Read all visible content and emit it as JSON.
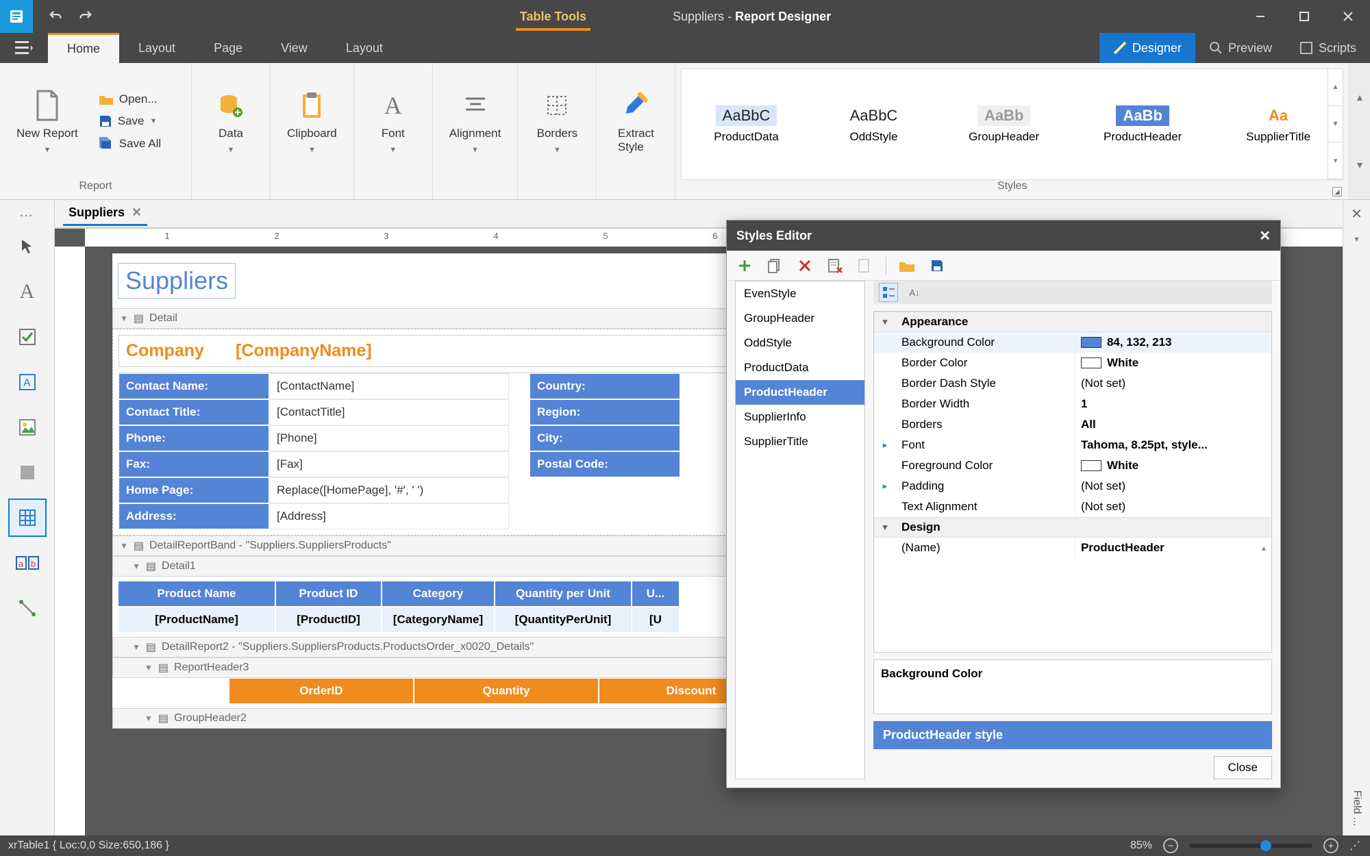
{
  "app": {
    "context_tab": "Table Tools",
    "doc_name": "Suppliers",
    "title_suffix": "Report Designer"
  },
  "ribbon_tabs": [
    "Home",
    "Layout",
    "Page",
    "View",
    "Layout"
  ],
  "modes": {
    "designer": "Designer",
    "preview": "Preview",
    "scripts": "Scripts"
  },
  "ribbon": {
    "report_group": "Report",
    "new_report": "New Report",
    "open": "Open...",
    "save": "Save",
    "save_all": "Save All",
    "data": "Data",
    "clipboard": "Clipboard",
    "font": "Font",
    "alignment": "Alignment",
    "borders": "Borders",
    "extract_style": "Extract\nStyle",
    "styles_group": "Styles"
  },
  "style_items": [
    {
      "name": "ProductData",
      "sample": "AaBbC",
      "bg": "#d6e6fb",
      "fg": "#222",
      "bold": false
    },
    {
      "name": "OddStyle",
      "sample": "AaBbC",
      "bg": "#ffffff",
      "fg": "#222",
      "bold": false
    },
    {
      "name": "GroupHeader",
      "sample": "AaBb",
      "bg": "#efefef",
      "fg": "#9a9a9a",
      "bold": true
    },
    {
      "name": "ProductHeader",
      "sample": "AaBb",
      "bg": "#5484d5",
      "fg": "#ffffff",
      "bold": true
    },
    {
      "name": "SupplierTitle",
      "sample": "Aa",
      "bg": "#ffffff",
      "fg": "#f08b1d",
      "bold": true
    }
  ],
  "doc_tab": "Suppliers",
  "ruler_ticks": [
    "1",
    "2",
    "3",
    "4",
    "5",
    "6"
  ],
  "report": {
    "title": "Suppliers",
    "band_detail": "Detail",
    "company_label": "Company",
    "company_value": "[CompanyName]",
    "rows": [
      {
        "l": "Contact Name:",
        "v": "[ContactName]",
        "r": "Country:"
      },
      {
        "l": "Contact Title:",
        "v": "[ContactTitle]",
        "r": "Region:"
      },
      {
        "l": "Phone:",
        "v": "[Phone]",
        "r": "City:"
      },
      {
        "l": "Fax:",
        "v": "[Fax]",
        "r": "Postal Code:"
      },
      {
        "l": "Home Page:",
        "v": "Replace([HomePage], '#', ' ')",
        "r": ""
      },
      {
        "l": "Address:",
        "v": "[Address]",
        "r": ""
      }
    ],
    "band_detailreport": "DetailReportBand - \"Suppliers.SuppliersProducts\"",
    "band_detail1": "Detail1",
    "products_header": [
      "Product Name",
      "Product ID",
      "Category",
      "Quantity per Unit",
      "U..."
    ],
    "products_row": [
      "[ProductName]",
      "[ProductID]",
      "[CategoryName]",
      "[QuantityPerUnit]",
      "[U"
    ],
    "band_detailreport2": "DetailReport2 - \"Suppliers.SuppliersProducts.ProductsOrder_x0020_Details\"",
    "band_reportheader3": "ReportHeader3",
    "orders_header": [
      "OrderID",
      "Quantity",
      "Discount"
    ],
    "band_groupheader2": "GroupHeader2"
  },
  "right_dock": {
    "field": "Field ..."
  },
  "styles_editor": {
    "title": "Styles Editor",
    "list": [
      "EvenStyle",
      "GroupHeader",
      "OddStyle",
      "ProductData",
      "ProductHeader",
      "SupplierInfo",
      "SupplierTitle"
    ],
    "selected": "ProductHeader",
    "categories": {
      "appearance": "Appearance",
      "design": "Design"
    },
    "props": {
      "bgcolor_k": "Background Color",
      "bgcolor_v": "84, 132, 213",
      "bgcolor_hex": "#5484d5",
      "bordercolor_k": "Border Color",
      "bordercolor_v": "White",
      "bordercolor_hex": "#ffffff",
      "dash_k": "Border Dash Style",
      "dash_v": "(Not set)",
      "bwidth_k": "Border Width",
      "bwidth_v": "1",
      "borders_k": "Borders",
      "borders_v": "All",
      "font_k": "Font",
      "font_v": "Tahoma, 8.25pt, style...",
      "fg_k": "Foreground Color",
      "fg_v": "White",
      "fg_hex": "#ffffff",
      "padding_k": "Padding",
      "padding_v": "(Not set)",
      "align_k": "Text Alignment",
      "align_v": "(Not set)",
      "name_k": "(Name)",
      "name_v": "ProductHeader"
    },
    "help_caption": "Background Color",
    "style_caption": "ProductHeader style",
    "close": "Close"
  },
  "status": {
    "selection": "xrTable1 { Loc:0,0 Size:650,186 }",
    "zoom": "85%"
  }
}
